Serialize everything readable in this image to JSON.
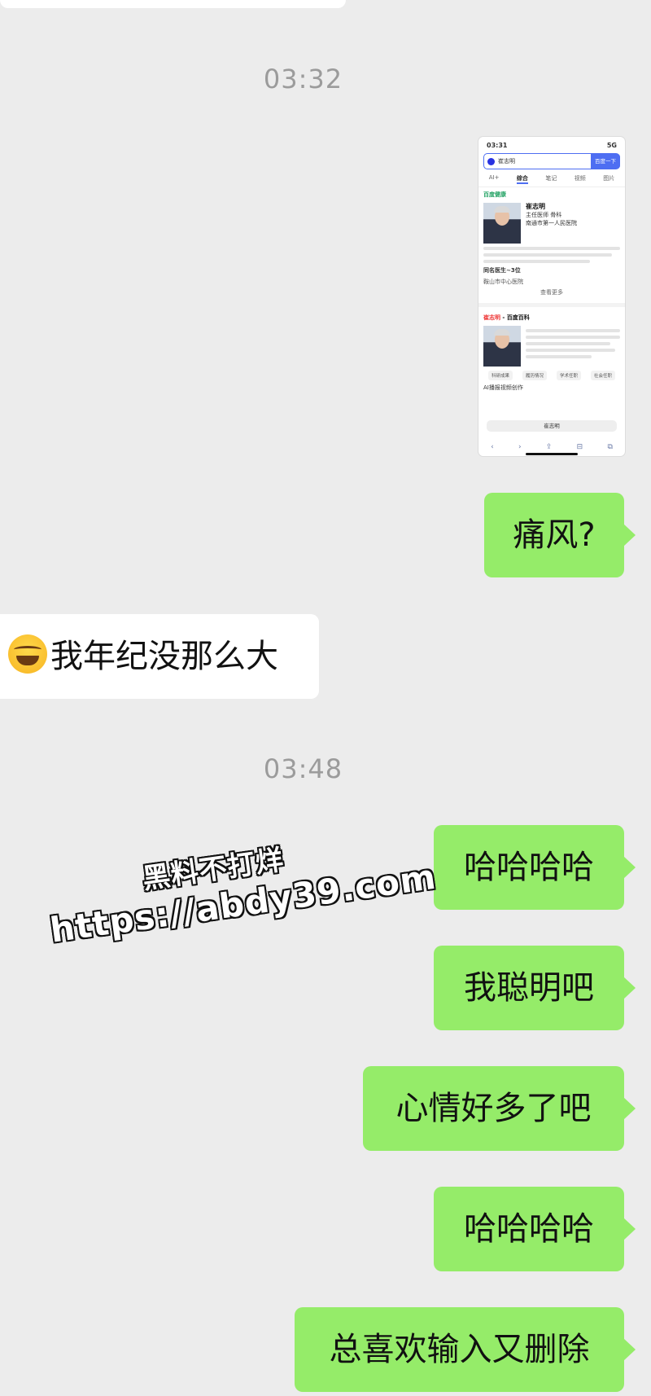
{
  "timestamps": [
    "03:32",
    "03:48"
  ],
  "shared_screenshot": {
    "status_time": "03:31",
    "status_network": "5G",
    "search_query": "崔志明",
    "search_button": "百度一下",
    "tabs": [
      "AI+",
      "综合",
      "笔记",
      "视频",
      "图片"
    ],
    "brand": "百度健康",
    "doctor_name": "崔志明",
    "doctor_title": "主任医师 骨科",
    "hospital": "南通市第一人民医院",
    "related_header": "同名医生~3位",
    "related_hospital": "鞍山市中心医院",
    "see_more": "查看更多",
    "baike_name": "崔志明",
    "baike_label": "百度百科",
    "pills": [
      "科研成果",
      "履历情况",
      "学术任职",
      "社会任职"
    ],
    "ai_banner": "AI播报视频创作",
    "address_bar": "崔志明",
    "toolbar_icons": [
      "back-icon",
      "forward-icon",
      "share-icon",
      "bookmarks-icon",
      "tabs-icon"
    ]
  },
  "messages": [
    {
      "side": "sent",
      "text": "痛风?"
    },
    {
      "side": "received",
      "emoji": "laugh-tears",
      "text": "我年纪没那么大"
    },
    {
      "side": "sent",
      "text": "哈哈哈哈"
    },
    {
      "side": "sent",
      "text": "我聪明吧"
    },
    {
      "side": "sent",
      "text": "心情好多了吧"
    },
    {
      "side": "sent",
      "text": "哈哈哈哈"
    },
    {
      "side": "sent",
      "text": "总喜欢输入又删除"
    }
  ],
  "watermark": {
    "line1": "黑料不打烊",
    "line2": "https://abdy39.com"
  },
  "colors": {
    "background": "#ececec",
    "sent_bubble": "#95ec69",
    "received_bubble": "#ffffff",
    "timestamp": "#9b9b9b"
  }
}
